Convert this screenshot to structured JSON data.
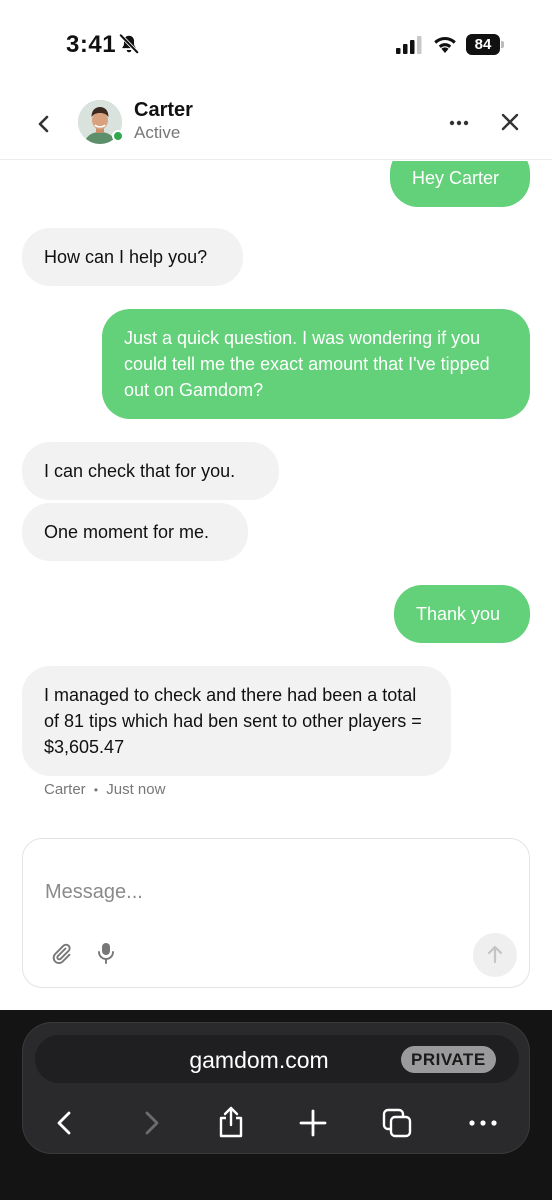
{
  "status_bar": {
    "time": "3:41",
    "battery": "84"
  },
  "header": {
    "name": "Carter",
    "status": "Active"
  },
  "messages": [
    {
      "side": "out",
      "text": "Hey Carter"
    },
    {
      "side": "in",
      "text": "How can I help you?"
    },
    {
      "side": "out",
      "text": "Just a quick question. I was wondering if you could tell me the exact amount that I've tipped out on Gamdom?"
    },
    {
      "side": "in",
      "text": "I can check that for you."
    },
    {
      "side": "in",
      "text": "One moment for me."
    },
    {
      "side": "out",
      "text": "Thank you"
    },
    {
      "side": "in",
      "text": "I managed to check and there had been a total of 81 tips which had ben sent to other players = $3,605.47"
    }
  ],
  "last_message_meta": {
    "author": "Carter",
    "separator": "•",
    "time": "Just now"
  },
  "composer": {
    "placeholder": "Message..."
  },
  "browser": {
    "url": "gamdom.com",
    "badge": "PRIVATE"
  },
  "colors": {
    "outgoing_bubble": "#63d07a",
    "incoming_bubble": "#f2f2f2",
    "online": "#2fa84f"
  },
  "icons": [
    "bell-slash-icon",
    "signal-icon",
    "wifi-icon",
    "battery-icon",
    "chevron-left-icon",
    "ellipsis-icon",
    "close-icon",
    "paperclip-icon",
    "microphone-icon",
    "arrow-up-icon",
    "share-icon",
    "plus-icon",
    "tabs-icon"
  ]
}
